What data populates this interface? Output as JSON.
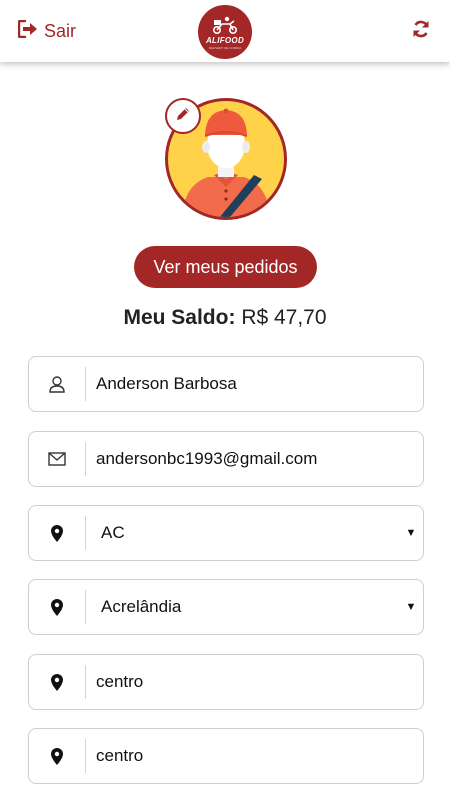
{
  "header": {
    "logout_label": "Sair",
    "logo_text": "ALIFOOD",
    "logo_subtext": "DELIVERY DE COMIDA"
  },
  "profile": {
    "orders_button_label": "Ver meus pedidos",
    "balance_label": "Meu Saldo:",
    "balance_value": "R$ 47,70"
  },
  "form": {
    "name": "Anderson Barbosa",
    "email": "andersonbc1993@gmail.com",
    "state": "AC",
    "city": "Acrelândia",
    "district": "centro",
    "address": "centro"
  },
  "colors": {
    "brand": "#a32727",
    "avatar_background": "#ffd24a"
  },
  "icons": {
    "logout": "sign-out-icon",
    "refresh": "refresh-icon",
    "edit": "pencil-icon",
    "name": "user-icon",
    "email": "envelope-icon",
    "location": "map-marker-icon"
  }
}
